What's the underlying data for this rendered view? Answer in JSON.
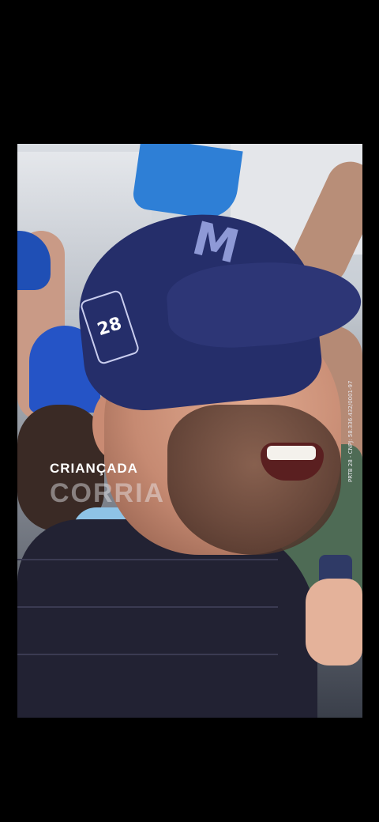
{
  "cap": {
    "logo_letter": "M",
    "badge_number": "28"
  },
  "caption": {
    "line1": "CRIANÇADA",
    "line2": "CORRIA"
  },
  "legal_text": "PRTB 28 - CNPJ: 58.336.432/0001-97"
}
